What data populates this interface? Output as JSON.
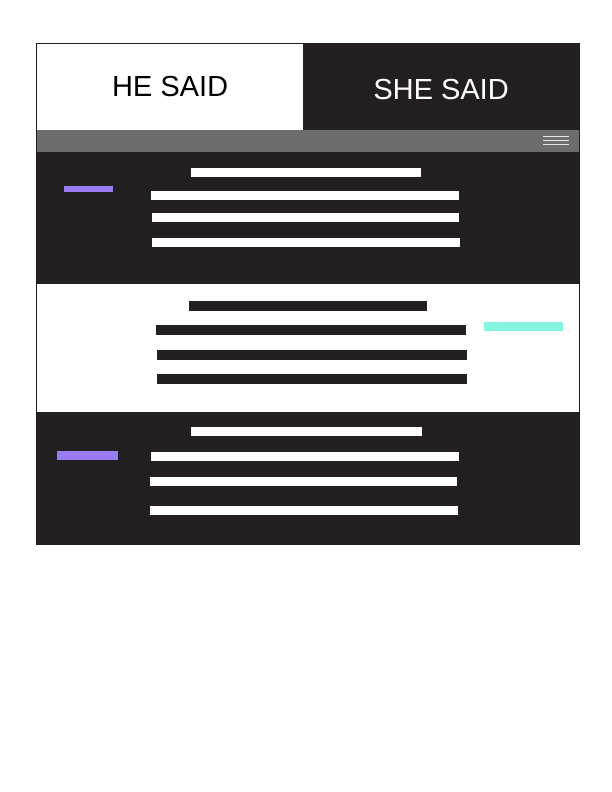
{
  "header": {
    "tab_he_label": "HE SAID",
    "tab_she_label": "SHE SAID"
  },
  "menu": {
    "icon": "hamburger-menu-icon"
  },
  "colors": {
    "dark": "#231f20",
    "light": "#ffffff",
    "menubar": "#6d6d6d",
    "accent_purple": "#9b7bf2",
    "accent_mint": "#83f5e0"
  }
}
